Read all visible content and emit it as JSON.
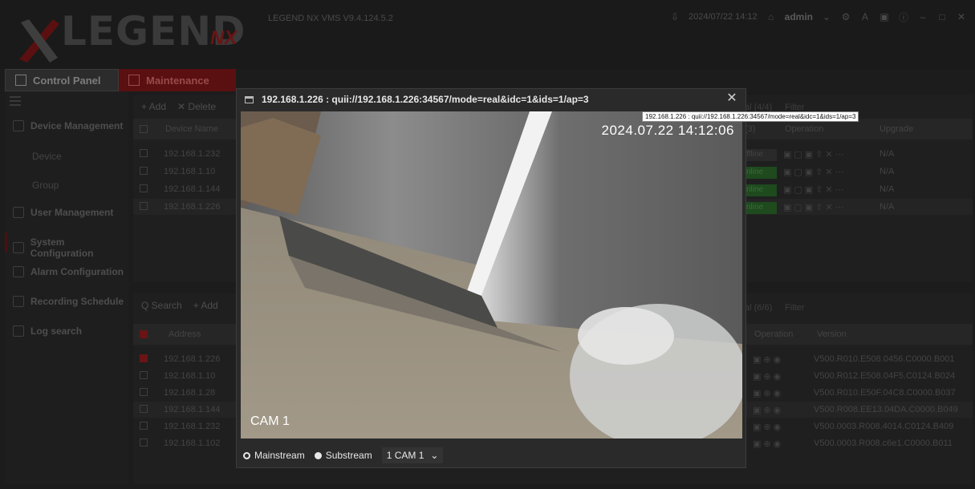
{
  "header": {
    "app_version": "LEGEND NX VMS V9.4.124.5.2",
    "logo_text": "LEGEND",
    "logo_suffix": "NX",
    "datetime": "2024/07/22 14:12",
    "user": "admin"
  },
  "tabs": [
    {
      "label": "Control Panel",
      "active": false
    },
    {
      "label": "Maintenance",
      "active": true
    }
  ],
  "sidebar": {
    "items": [
      {
        "label": "Device Management"
      },
      {
        "label": "User Management"
      },
      {
        "label": "System Configuration"
      },
      {
        "label": "Alarm Configuration"
      },
      {
        "label": "Recording Schedule"
      },
      {
        "label": "Log search"
      }
    ],
    "subitems": [
      "Device",
      "Group"
    ]
  },
  "device_panel": {
    "toolbar": [
      "+ Add",
      "✕ Delete"
    ],
    "total": "al (4/4)",
    "filter": "Filter",
    "columns": [
      "Device Name",
      "(3)",
      "Operation",
      "Upgrade"
    ],
    "rows": [
      {
        "name": "192.168.1.232",
        "status": "ffline",
        "online": false,
        "upgrade": "N/A"
      },
      {
        "name": "192.168.1.10",
        "status": "nline",
        "online": true,
        "upgrade": "N/A"
      },
      {
        "name": "192.168.1.144",
        "status": "nline",
        "online": true,
        "upgrade": "N/A"
      },
      {
        "name": "192.168.1.226",
        "status": "nline",
        "online": true,
        "upgrade": "N/A"
      }
    ]
  },
  "search_panel": {
    "toolbar": [
      "Q Search",
      "+ Add"
    ],
    "total": "al (6/6)",
    "filter": "Filter",
    "columns": [
      "Address",
      "Operation",
      "Version"
    ],
    "rows": [
      {
        "address": "192.168.1.226",
        "checked": true,
        "version": "V500.R010.E508.0456.C0000.B001"
      },
      {
        "address": "192.168.1.10",
        "checked": false,
        "version": "V500.R012.E508.04F5.C0124.B024"
      },
      {
        "address": "192.168.1.28",
        "checked": false,
        "version": "V500.R010.E50F.04C8.C0000.B037"
      },
      {
        "address": "192.168.1.144",
        "checked": false,
        "version": "V500.R008.EE13.04DA.C0000.B049"
      },
      {
        "address": "192.168.1.232",
        "checked": false,
        "version": "V500.0003.R008.4014.C0124.B409"
      },
      {
        "address": "192.168.1.102",
        "checked": false,
        "version": "V500.0003.R008.c6e1.C0000.B011"
      }
    ]
  },
  "modal": {
    "title": "192.168.1.226 : quii://192.168.1.226:34567/mode=real&idc=1&ids=1/ap=3",
    "tooltip": "192.168.1.226 : quii://192.168.1.226:34567/mode=real&idc=1&ids=1/ap=3",
    "timestamp": "2024.07.22 14:12:06",
    "camera_label": "CAM 1",
    "streams": [
      {
        "label": "Mainstream",
        "selected": false
      },
      {
        "label": "Substream",
        "selected": true
      }
    ],
    "camera_select": "1 CAM 1"
  },
  "colors": {
    "accent_red": "#6a1414",
    "online_green": "#1e4a1e",
    "background": "#1c1c1c"
  }
}
